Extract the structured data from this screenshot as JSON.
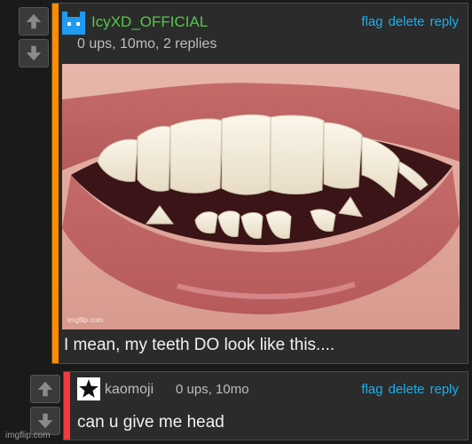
{
  "comments": [
    {
      "author": "IcyXD_OFFICIAL",
      "author_color": "#53c84b",
      "accent_color": "#ff8c00",
      "avatar_icon": "blue-pixel-cat-icon",
      "meta": "0 ups, 10mo, 2 replies",
      "actions": {
        "flag": "flag",
        "delete": "delete",
        "reply": "reply"
      },
      "image_watermark": "imgflip.com",
      "text": "I mean, my teeth DO look like this...."
    },
    {
      "author": "kaomoji",
      "author_color": "#bdbdbd",
      "accent_color": "#f03c3c",
      "avatar_icon": "star-icon",
      "meta": "0 ups, 10mo",
      "actions": {
        "flag": "flag",
        "delete": "delete",
        "reply": "reply"
      },
      "text": "can u give me head"
    }
  ],
  "site_watermark": "imgflip.com",
  "action_color": "#19b0f0"
}
